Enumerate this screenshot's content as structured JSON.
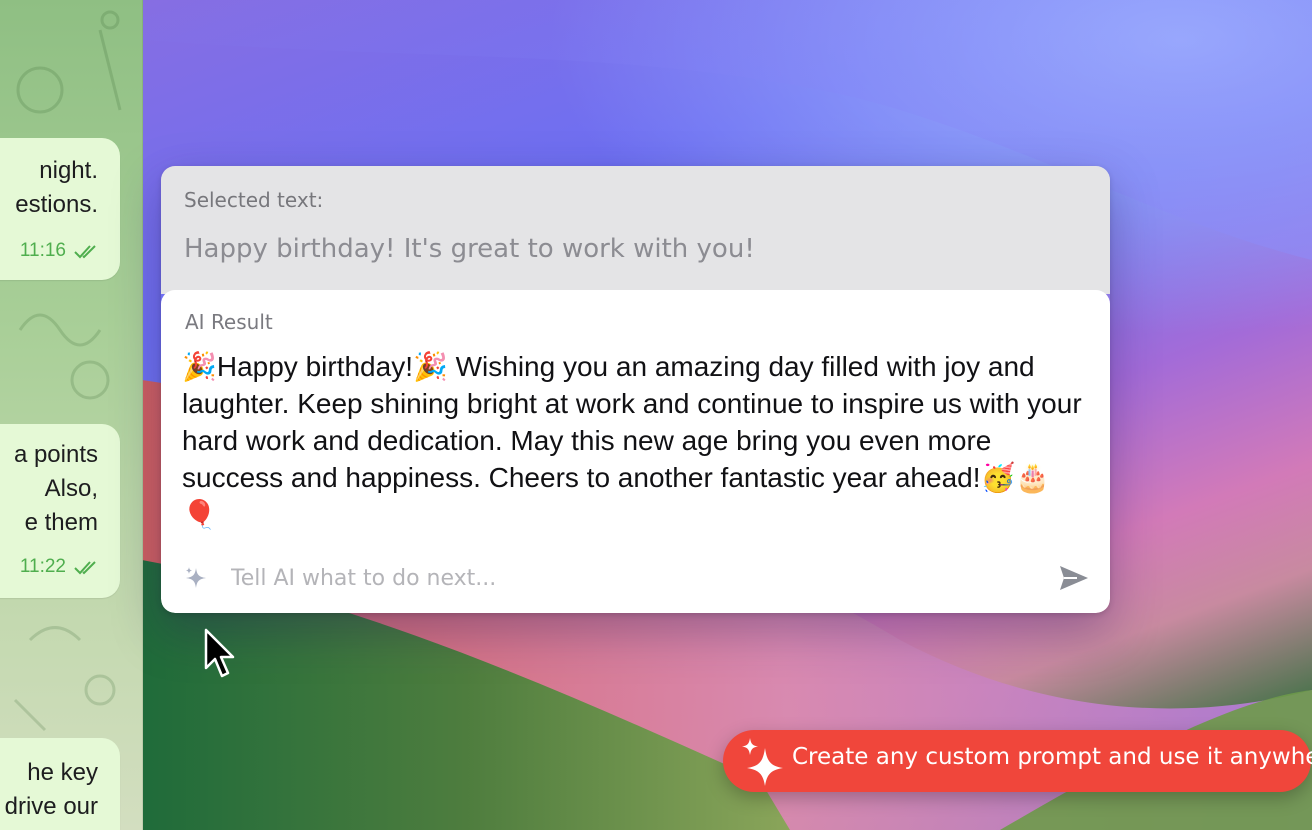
{
  "chat": {
    "bubbles": [
      {
        "lines": [
          "night.",
          "estions."
        ],
        "time": "11:16"
      },
      {
        "lines": [
          "a points",
          "Also,",
          "e them"
        ],
        "time": "11:22"
      },
      {
        "lines": [
          "he key",
          "drive our"
        ]
      }
    ],
    "read_icon": "double-check-icon",
    "accent": "#4fae4e"
  },
  "popup": {
    "selected_label": "Selected text:",
    "selected_text": "Happy birthday! It's great to work with you!",
    "result_label": "AI Result",
    "result_text": "🎉Happy birthday!🎉 Wishing you an amazing day filled with joy and laughter. Keep shining bright at work and continue to inspire us with your hard work and dedication. May this new age bring you even more success and happiness. Cheers to another fantastic year ahead!🥳🎂🎈",
    "prompt_placeholder": "Tell AI what to do next...",
    "prompt_icon": "sparkle-icon",
    "send_icon": "send-icon"
  },
  "promo": {
    "text": "Create any custom prompt and use it anywhere",
    "icon": "sparkles-icon",
    "color": "#f0463b"
  }
}
